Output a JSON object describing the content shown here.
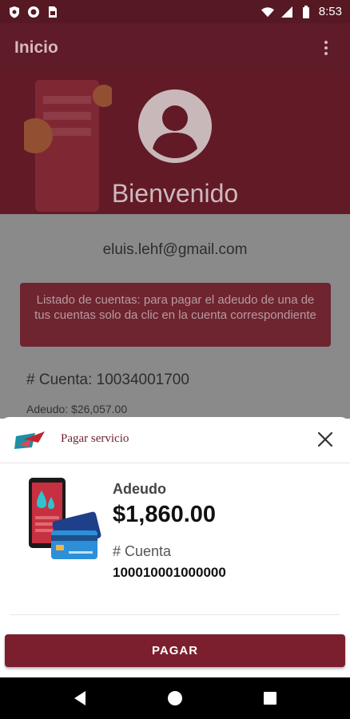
{
  "status_bar": {
    "time": "8:53",
    "left_icons": [
      "shield-icon",
      "record-icon",
      "sim-card-icon"
    ],
    "right_icons": [
      "wifi-icon",
      "signal-icon",
      "battery-icon"
    ]
  },
  "toolbar": {
    "title": "Inicio",
    "menu_icon": "overflow-menu-icon"
  },
  "header": {
    "welcome": "Bienvenido",
    "avatar_icon": "user-avatar-icon"
  },
  "content": {
    "email": "eluis.lehf@gmail.com",
    "info_message": "Listado de cuentas: para pagar el adeudo de una de tus cuentas solo da clic en la cuenta correspondiente",
    "account_title": "# Cuenta: 10034001700",
    "account_debt": "Adeudo: $26,057.00"
  },
  "sheet": {
    "title": "Pagar servicio",
    "debt_label": "Adeudo",
    "amount": "$1,860.00",
    "account_label": "# Cuenta",
    "account_number": "100010001000000",
    "pay_button": "PAGAR"
  },
  "colors": {
    "brand": "#7b1f2e",
    "toolbar": "#5f1b27",
    "header": "#611a26"
  },
  "nav_bar": {
    "icons": [
      "back-icon",
      "home-icon",
      "recents-icon"
    ]
  }
}
